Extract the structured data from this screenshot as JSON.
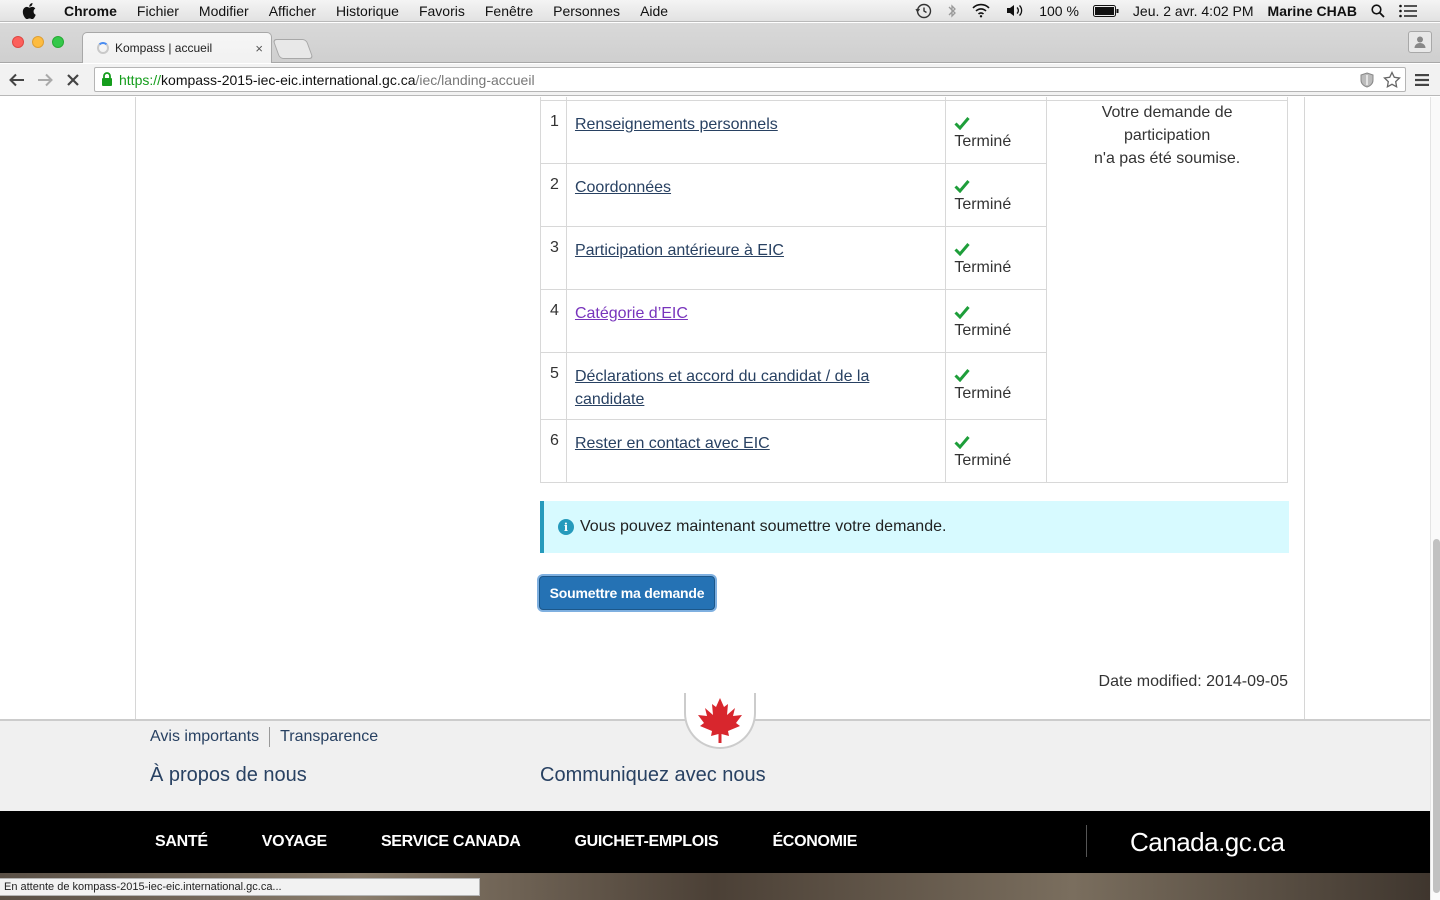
{
  "menubar": {
    "app": "Chrome",
    "items": [
      "Fichier",
      "Modifier",
      "Afficher",
      "Historique",
      "Favoris",
      "Fenêtre",
      "Personnes",
      "Aide"
    ],
    "battery": "100 %",
    "datetime": "Jeu. 2 avr.  4:02 PM",
    "user": "Marine CHAB"
  },
  "tab": {
    "title": "Kompass | accueil",
    "close": "×"
  },
  "omnibox": {
    "scheme": "https://",
    "host": "kompass-2015-iec-eic.international.gc.ca",
    "path": "/iec/landing-accueil"
  },
  "table": {
    "rows": [
      {
        "num": "1",
        "label": "Renseignements personnels",
        "status": "Terminé"
      },
      {
        "num": "2",
        "label": "Coordonnées",
        "status": "Terminé"
      },
      {
        "num": "3",
        "label": "Participation antérieure à EIC",
        "status": "Terminé"
      },
      {
        "num": "4",
        "label": "Catégorie d’EIC",
        "status": "Terminé"
      },
      {
        "num": "5",
        "label": "Déclarations et accord du candidat / de la candidate",
        "status": "Terminé"
      },
      {
        "num": "6",
        "label": "Rester en contact avec EIC",
        "status": "Terminé"
      }
    ],
    "summary_line1": "Votre demande de participation",
    "summary_line2": "n'a pas été soumise."
  },
  "alert": {
    "text": "Vous pouvez maintenant soumettre votre demande."
  },
  "submit_button": "Soumettre ma demande",
  "date_modified": {
    "label": "Date modified: ",
    "value": "2014-09-05"
  },
  "footer": {
    "links": [
      "Avis importants",
      "Transparence"
    ],
    "about": "À propos de nous",
    "contact": "Communiquez avec nous"
  },
  "blackbar": {
    "themes": [
      "SANTÉ",
      "VOYAGE",
      "SERVICE CANADA",
      "GUICHET-EMPLOIS",
      "ÉCONOMIE"
    ],
    "canada": "Canada.gc.ca"
  },
  "status_bubble": "En attente de kompass-2015-iec-eic.international.gc.ca...",
  "colors": {
    "link": "#284162",
    "visited": "#7834bc",
    "check": "#1e9e3a",
    "button": "#2572b4",
    "alert_bg": "#d7faff",
    "alert_border": "#269abc"
  }
}
